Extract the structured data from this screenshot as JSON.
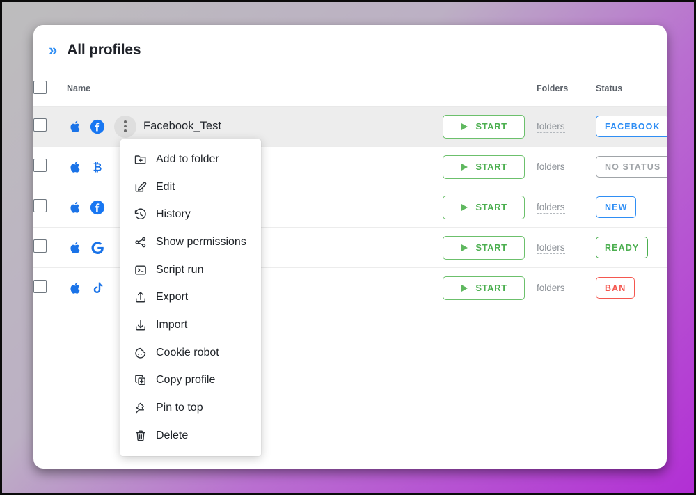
{
  "header": {
    "expand_icon": "double-chevron-right-icon",
    "title": "All profiles"
  },
  "table": {
    "columns": {
      "name": "Name",
      "folders": "Folders",
      "status": "Status"
    },
    "start_label": "START",
    "folders_label": "folders",
    "rows": [
      {
        "name": "Facebook_Test",
        "icons": [
          "apple-icon",
          "facebook-icon"
        ],
        "start": "START",
        "folders": "folders",
        "status": "FACEBOOK",
        "status_color": "#2f8ef4",
        "selected": true
      },
      {
        "name": "",
        "icons": [
          "apple-icon",
          "bitcoin-icon"
        ],
        "start": "START",
        "folders": "folders",
        "status": "NO STATUS",
        "status_color": "#a0a4a8",
        "selected": false
      },
      {
        "name": "",
        "icons": [
          "apple-icon",
          "facebook-icon"
        ],
        "start": "START",
        "folders": "folders",
        "status": "NEW",
        "status_color": "#2f8ef4",
        "selected": false
      },
      {
        "name": "",
        "icons": [
          "apple-icon",
          "google-icon"
        ],
        "start": "START",
        "folders": "folders",
        "status": "READY",
        "status_color": "#4caf50",
        "selected": false
      },
      {
        "name": "",
        "icons": [
          "apple-icon",
          "tiktok-icon"
        ],
        "start": "START",
        "folders": "folders",
        "status": "BAN",
        "status_color": "#f4574f",
        "selected": false
      }
    ]
  },
  "context_menu": {
    "items": [
      {
        "label": "Add to folder",
        "icon": "folder-plus-icon"
      },
      {
        "label": "Edit",
        "icon": "edit-pencil-icon"
      },
      {
        "label": "History",
        "icon": "history-clock-icon"
      },
      {
        "label": "Show permissions",
        "icon": "share-nodes-icon"
      },
      {
        "label": "Script run",
        "icon": "terminal-icon"
      },
      {
        "label": "Export",
        "icon": "upload-arrow-icon"
      },
      {
        "label": "Import",
        "icon": "download-arrow-icon"
      },
      {
        "label": "Cookie robot",
        "icon": "cookie-icon"
      },
      {
        "label": "Copy profile",
        "icon": "copy-plus-icon"
      },
      {
        "label": "Pin to top",
        "icon": "pin-icon"
      },
      {
        "label": "Delete",
        "icon": "trash-icon"
      }
    ]
  },
  "colors": {
    "accent_blue": "#2f8ef4",
    "start_green": "#4caf50",
    "ban_red": "#f4574f",
    "background_start": "#bdbdbd",
    "background_end": "#b22fd4"
  }
}
